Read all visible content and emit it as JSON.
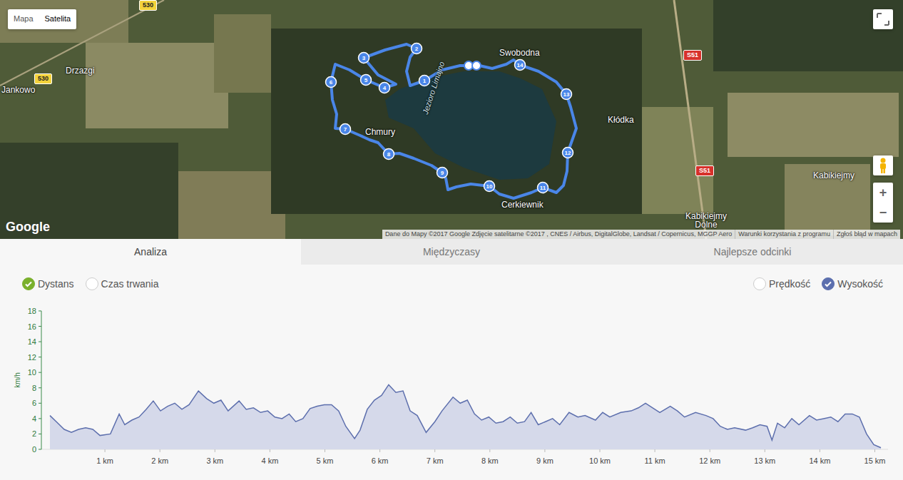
{
  "map": {
    "type_buttons": [
      {
        "label": "Mapa",
        "selected": false
      },
      {
        "label": "Satelita",
        "selected": true
      }
    ],
    "places": [
      {
        "name": "Jankowo",
        "kind": "place"
      },
      {
        "name": "Drzazgi",
        "kind": "place"
      },
      {
        "name": "Chmury",
        "kind": "place"
      },
      {
        "name": "Jezioro Limajno",
        "kind": "lake"
      },
      {
        "name": "Swobodna",
        "kind": "place"
      },
      {
        "name": "Cerkiewnik",
        "kind": "place"
      },
      {
        "name": "Kłódka",
        "kind": "place"
      },
      {
        "name": "Kabikiejmy",
        "kind": "place"
      },
      {
        "name": "Kabikiejmy Dolne",
        "kind": "place"
      }
    ],
    "road_signs": [
      {
        "label": "530",
        "color": "#f3d23b"
      },
      {
        "label": "530",
        "color": "#f3d23b"
      },
      {
        "label": "S51",
        "color": "#d7312b"
      },
      {
        "label": "S51",
        "color": "#d7312b"
      }
    ],
    "markers": [
      "1",
      "2",
      "3",
      "4",
      "5",
      "6",
      "7",
      "8",
      "9",
      "10",
      "11",
      "12",
      "13",
      "14"
    ],
    "logo": "Google",
    "attribution": [
      "Dane do Mapy ©2017 Google Zdjęcie satelitarne ©2017 , CNES / Airbus, DigitalGlobe, Landsat / Copernicus, MGGP Aero",
      "Warunki korzystania z programu",
      "Zgłoś błąd w mapach"
    ],
    "zoom": [
      "+",
      "−"
    ]
  },
  "tabs": [
    {
      "label": "Analiza",
      "selected": true
    },
    {
      "label": "Międzyczasy",
      "selected": false
    },
    {
      "label": "Najlepsze odcinki",
      "selected": false
    }
  ],
  "x_axis_options": [
    {
      "label": "Dystans",
      "selected": true
    },
    {
      "label": "Czas trwania",
      "selected": false
    }
  ],
  "series_options": [
    {
      "label": "Prędkość",
      "checked": false
    },
    {
      "label": "Wysokość",
      "checked": true
    }
  ],
  "chart": {
    "y_unit": "km/h",
    "y_ticks": [
      "0",
      "2",
      "4",
      "6",
      "8",
      "10",
      "12",
      "14",
      "16",
      "18"
    ],
    "x_ticks": [
      "1 km",
      "2 km",
      "3 km",
      "4 km",
      "5 km",
      "6 km",
      "7 km",
      "8 km",
      "9 km",
      "10 km",
      "11 km",
      "12 km",
      "13 km",
      "14 km",
      "15 km"
    ],
    "x_km": [
      0,
      0.13,
      0.26,
      0.39,
      0.52,
      0.65,
      0.78,
      0.91,
      1.1,
      1.26,
      1.36,
      1.49,
      1.62,
      1.75,
      1.88,
      2.01,
      2.14,
      2.27,
      2.4,
      2.53,
      2.7,
      2.85,
      2.98,
      3.11,
      3.24,
      3.44,
      3.57,
      3.7,
      3.83,
      3.96,
      4.09,
      4.22,
      4.35,
      4.47,
      4.6,
      4.73,
      4.86,
      4.99,
      5.12,
      5.25,
      5.38,
      5.54,
      5.64,
      5.77,
      5.9,
      6.03,
      6.16,
      6.29,
      6.42,
      6.55,
      6.68,
      6.84,
      7.0,
      7.13,
      7.33,
      7.46,
      7.59,
      7.72,
      7.85,
      7.98,
      8.11,
      8.24,
      8.37,
      8.5,
      8.63,
      8.75,
      8.88,
      9.01,
      9.14,
      9.27,
      9.44,
      9.6,
      9.73,
      9.92,
      10.05,
      10.18,
      10.38,
      10.57,
      10.7,
      10.83,
      10.96,
      11.09,
      11.28,
      11.41,
      11.54,
      11.74,
      11.93,
      12.06,
      12.19,
      12.32,
      12.45,
      12.65,
      12.78,
      12.91,
      13.04,
      13.13,
      13.23,
      13.36,
      13.49,
      13.62,
      13.81,
      13.94,
      14.07,
      14.2,
      14.33,
      14.46,
      14.59,
      14.72,
      14.85,
      14.98,
      15.11
    ],
    "speed_kmh": [
      4.4,
      3.5,
      2.6,
      2.2,
      2.6,
      2.8,
      2.6,
      1.8,
      2.0,
      4.6,
      3.2,
      3.8,
      4.2,
      5.2,
      6.3,
      5.0,
      5.6,
      6.0,
      5.2,
      5.8,
      7.6,
      6.6,
      6.0,
      6.4,
      5.0,
      6.3,
      5.2,
      5.4,
      4.8,
      5.0,
      4.2,
      4.0,
      4.6,
      3.6,
      4.0,
      5.3,
      5.6,
      5.8,
      5.8,
      5.0,
      3.0,
      1.4,
      2.5,
      5.2,
      6.4,
      7.0,
      8.4,
      7.4,
      7.6,
      5.0,
      4.4,
      2.2,
      3.6,
      5.0,
      6.8,
      6.0,
      6.4,
      4.6,
      3.8,
      4.2,
      3.4,
      3.6,
      4.2,
      3.4,
      3.6,
      4.8,
      3.2,
      3.6,
      4.0,
      3.2,
      4.8,
      4.2,
      4.4,
      3.8,
      4.8,
      4.2,
      4.8,
      5.0,
      5.4,
      6.0,
      5.4,
      4.8,
      5.6,
      5.0,
      4.2,
      4.8,
      4.4,
      4.0,
      3.0,
      2.6,
      2.8,
      2.5,
      2.8,
      3.2,
      3.0,
      1.2,
      3.4,
      2.8,
      4.0,
      3.2,
      4.4,
      3.8,
      4.0,
      4.2,
      3.6,
      4.6,
      4.6,
      4.2,
      2.0,
      0.6,
      0.2
    ]
  }
}
